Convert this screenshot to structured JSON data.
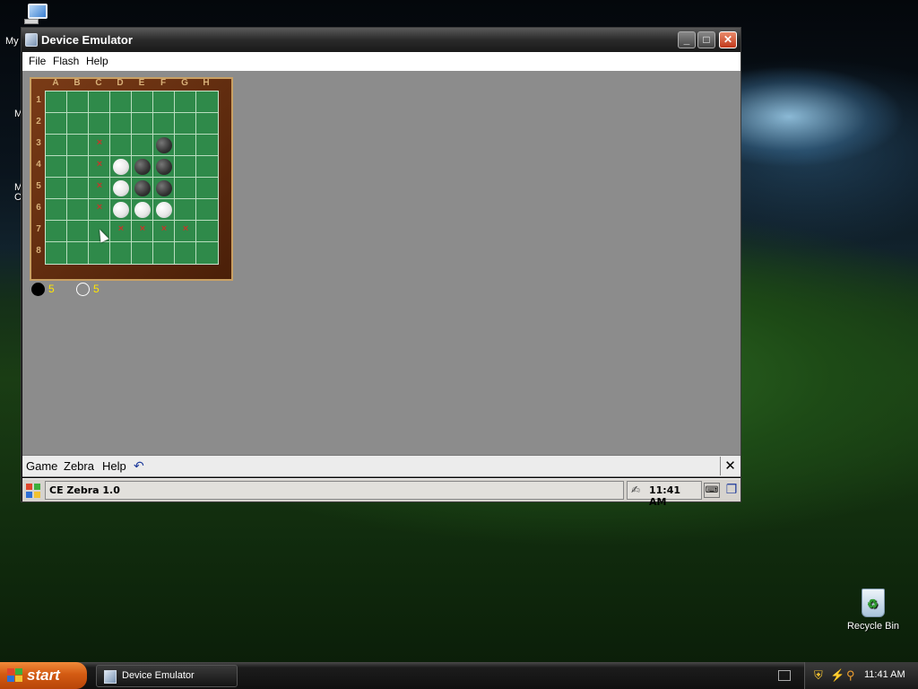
{
  "desktop": {
    "my_computer_label": "My",
    "fragment_1": "M",
    "fragment_2": "M",
    "fragment_3": "C",
    "recycle_bin_label": "Recycle Bin"
  },
  "window": {
    "title": "Device Emulator",
    "minimize": "_",
    "maximize": "□",
    "close": "✕",
    "menu": [
      "File",
      "Flash",
      "Help"
    ]
  },
  "board": {
    "columns": [
      "A",
      "B",
      "C",
      "D",
      "E",
      "F",
      "G",
      "H"
    ],
    "rows": [
      "1",
      "2",
      "3",
      "4",
      "5",
      "6",
      "7",
      "8"
    ],
    "cells": [
      [
        "",
        "",
        "",
        "",
        "",
        "",
        "",
        ""
      ],
      [
        "",
        "",
        "",
        "",
        "",
        "",
        "",
        ""
      ],
      [
        "",
        "",
        "x",
        "",
        "",
        "B",
        "",
        ""
      ],
      [
        "",
        "",
        "x",
        "W",
        "B",
        "B",
        "",
        ""
      ],
      [
        "",
        "",
        "x",
        "W",
        "B",
        "B",
        "",
        ""
      ],
      [
        "",
        "",
        "x",
        "W",
        "W",
        "W",
        "",
        ""
      ],
      [
        "",
        "",
        "",
        "x",
        "x",
        "x",
        "x",
        ""
      ],
      [
        "",
        "",
        "",
        "",
        "",
        "",
        "",
        ""
      ]
    ]
  },
  "score": {
    "black": "5",
    "white": "5"
  },
  "ce_menu": {
    "items": [
      "Game",
      "Zebra",
      "Help"
    ],
    "undo_icon": "↶",
    "close": "✕"
  },
  "ce_taskbar": {
    "task": "CE Zebra 1.0",
    "time": "11:41 AM"
  },
  "taskbar": {
    "start": "start",
    "task": "Device Emulator",
    "time": "11:41 AM"
  }
}
